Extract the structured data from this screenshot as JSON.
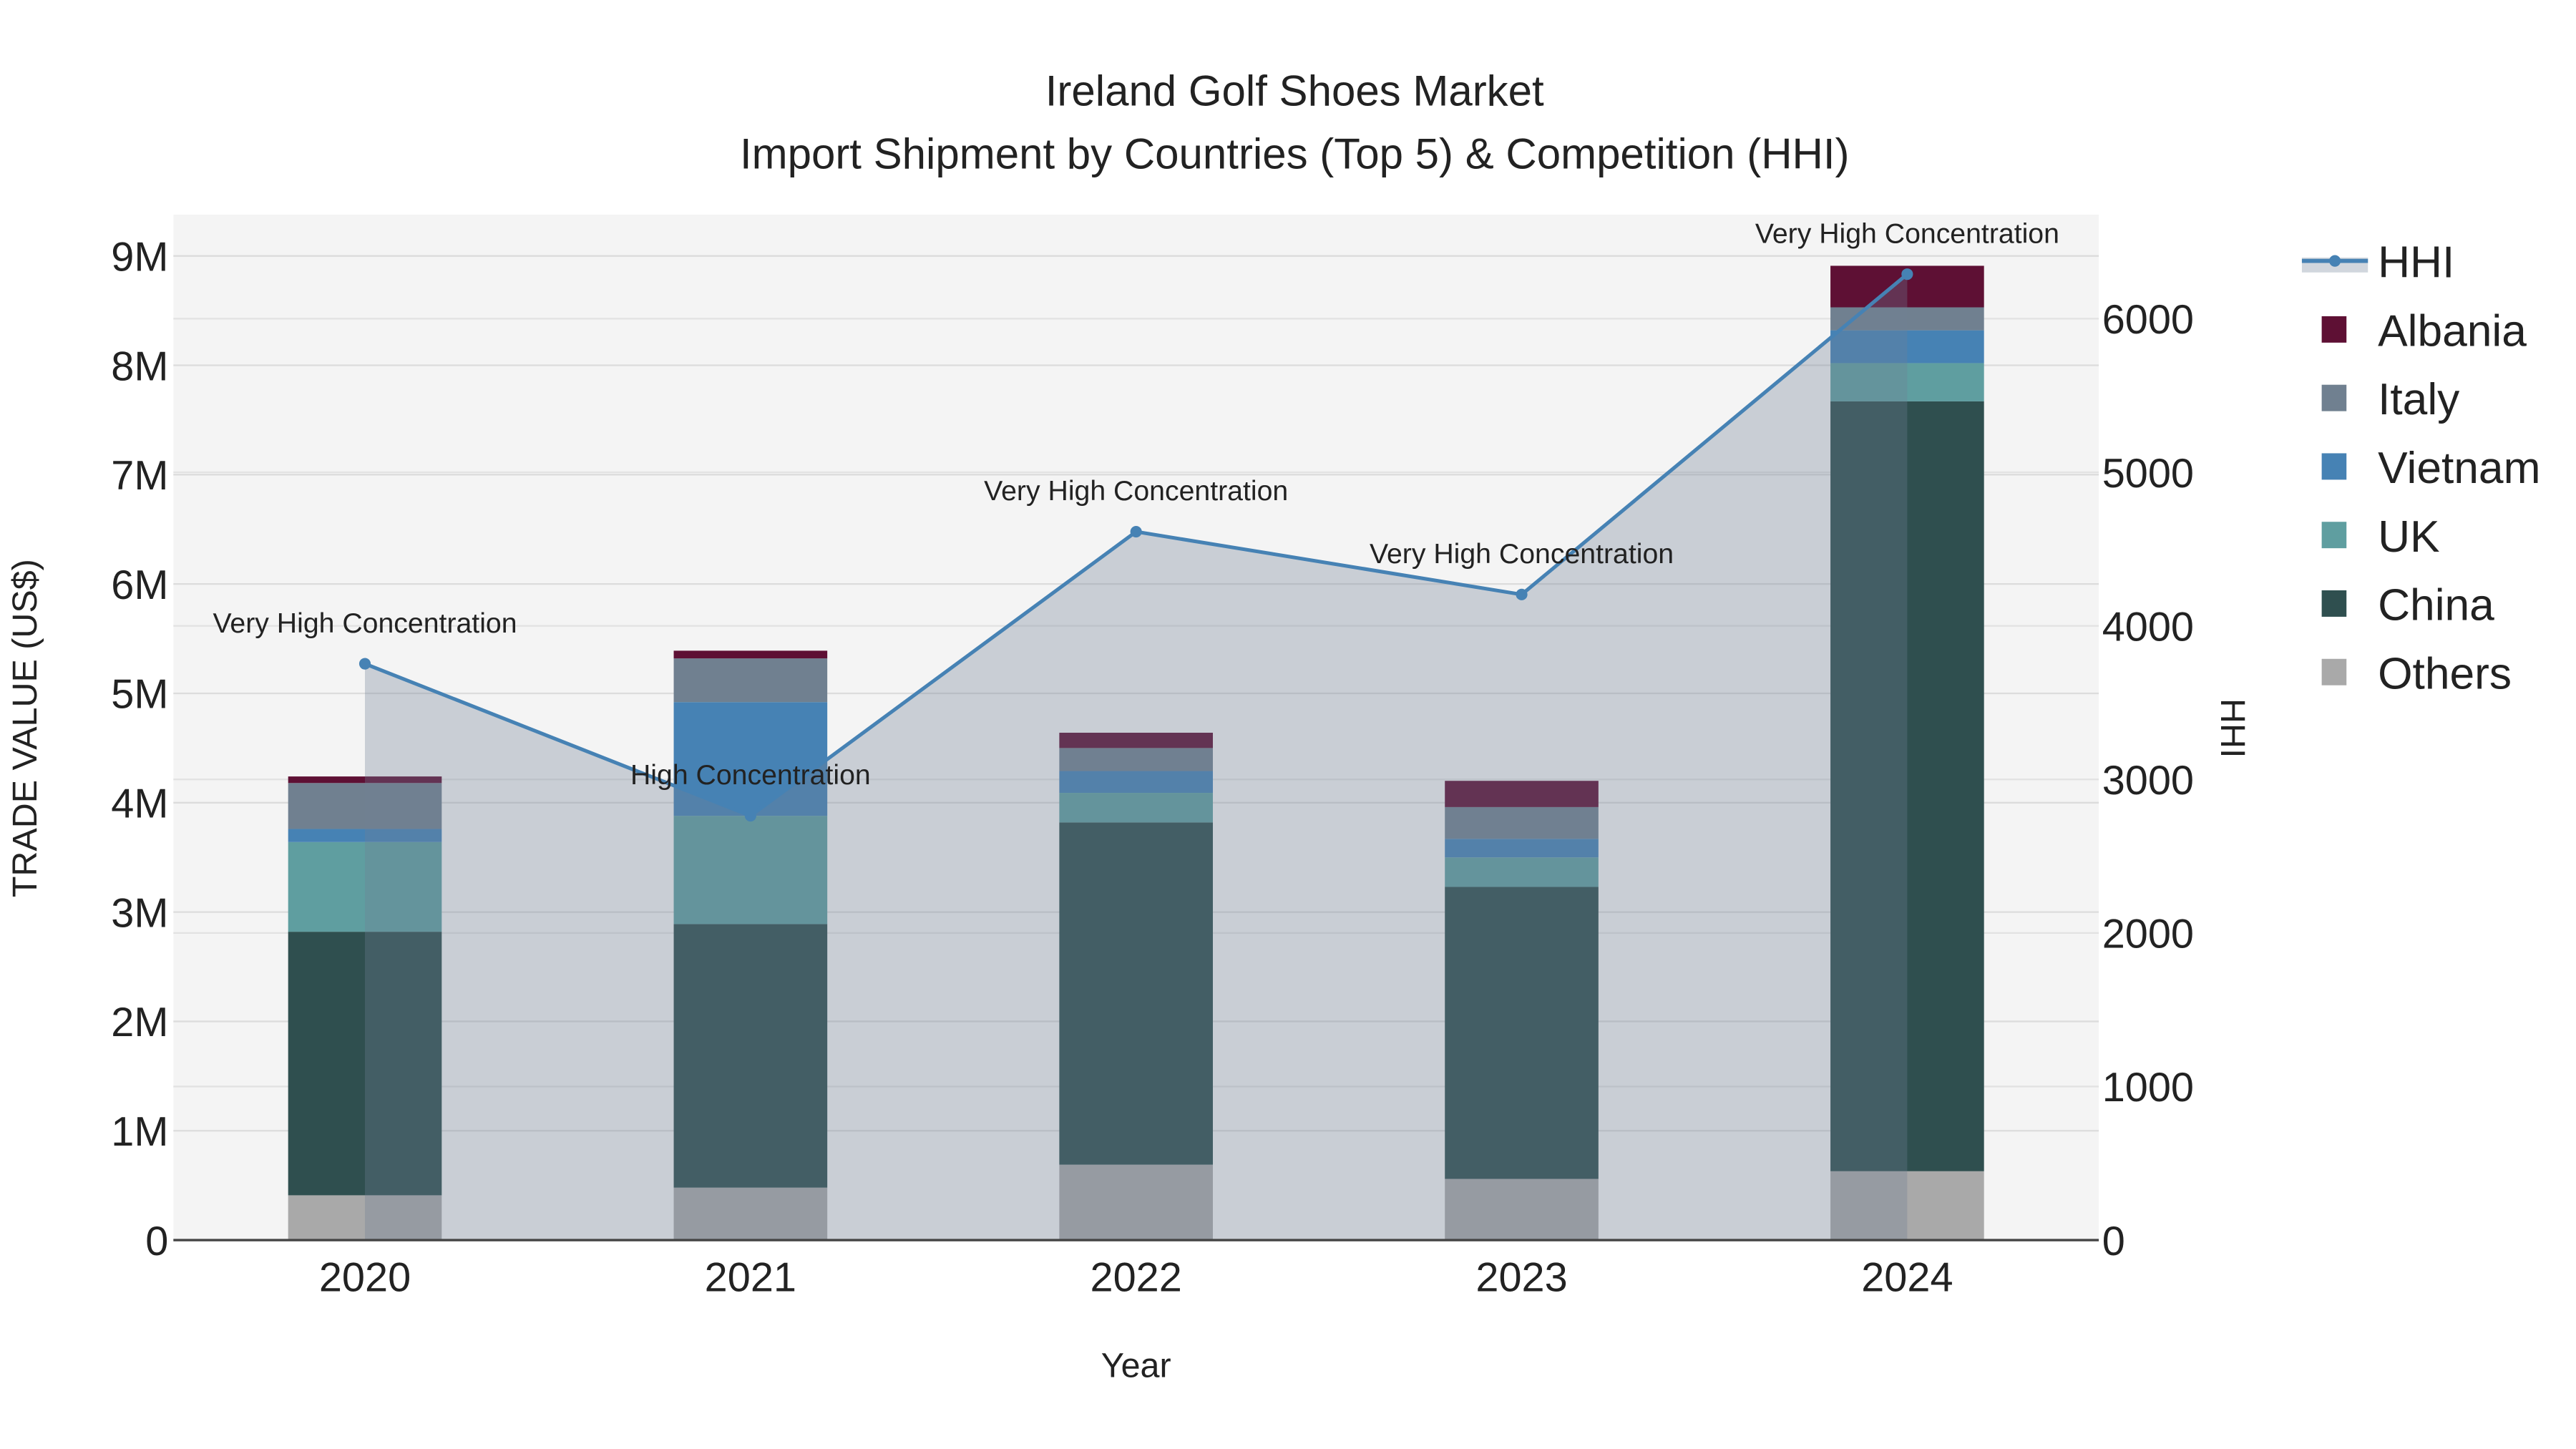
{
  "chart_data": {
    "type": "bar",
    "title": "Ireland Golf Shoes Market",
    "subtitle": "Import Shipment by Countries (Top 5) & Competition (HHI)",
    "xlabel": "Year",
    "ylabel": "TRADE VALUE (US$)",
    "y2label": "HHI",
    "categories": [
      "2020",
      "2021",
      "2022",
      "2023",
      "2024"
    ],
    "ylim": [
      0,
      9400000
    ],
    "y2lim": [
      0,
      6680
    ],
    "yticks": [
      0,
      1000000,
      2000000,
      3000000,
      4000000,
      5000000,
      6000000,
      7000000,
      8000000,
      9000000
    ],
    "ytick_labels": [
      "0",
      "1M",
      "2M",
      "3M",
      "4M",
      "5M",
      "6M",
      "7M",
      "8M",
      "9M"
    ],
    "y2ticks": [
      0,
      1000,
      2000,
      3000,
      4000,
      5000,
      6000
    ],
    "y2tick_labels": [
      "0",
      "1000",
      "2000",
      "3000",
      "4000",
      "5000",
      "6000"
    ],
    "series": [
      {
        "name": "Others",
        "color": "#a9a9a9",
        "values": [
          410000,
          480000,
          690000,
          560000,
          630000
        ]
      },
      {
        "name": "China",
        "color": "#2f4f4f",
        "values": [
          2410000,
          2410000,
          3130000,
          2670000,
          7040000
        ]
      },
      {
        "name": "UK",
        "color": "#5f9ea0",
        "values": [
          820000,
          990000,
          270000,
          270000,
          350000
        ]
      },
      {
        "name": "Vietnam",
        "color": "#4682b4",
        "values": [
          120000,
          1040000,
          200000,
          170000,
          300000
        ]
      },
      {
        "name": "Italy",
        "color": "#708090",
        "values": [
          420000,
          400000,
          210000,
          290000,
          210000
        ]
      },
      {
        "name": "Albania",
        "color": "#5e1034",
        "values": [
          60000,
          70000,
          140000,
          240000,
          380000
        ]
      }
    ],
    "hhi": {
      "name": "HHI",
      "color": "#4682b4",
      "values": [
        3753,
        2763,
        4613,
        4204,
        6290
      ],
      "annotations": [
        "Very High Concentration",
        "High Concentration",
        "Very High Concentration",
        "Very High Concentration",
        "Very High Concentration"
      ]
    },
    "legend_order": [
      "HHI",
      "Albania",
      "Italy",
      "Vietnam",
      "UK",
      "China",
      "Others"
    ],
    "legend_position": "right",
    "grid": true
  }
}
